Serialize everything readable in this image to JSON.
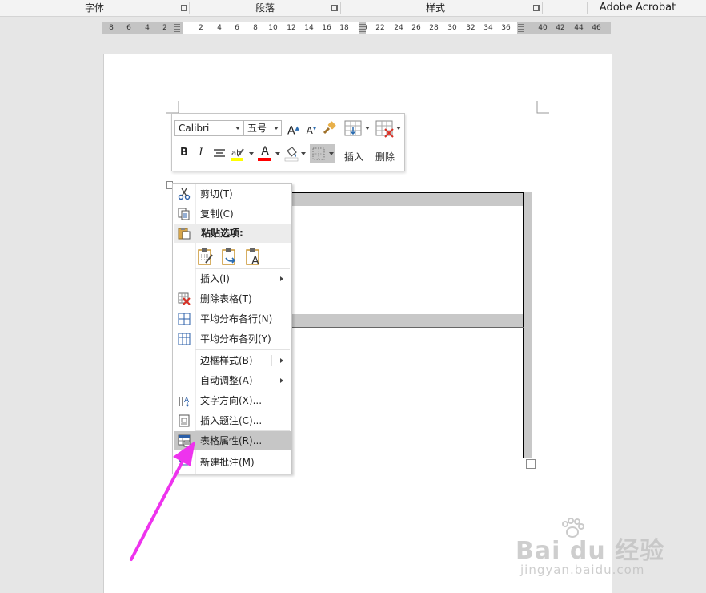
{
  "ribbon": {
    "groups": [
      "字体",
      "段落",
      "样式",
      "Adobe Acrobat"
    ]
  },
  "ruler": {
    "left_ticks": [
      "8",
      "6",
      "4",
      "2"
    ],
    "right_ticks": [
      "2",
      "4",
      "6",
      "8",
      "10",
      "12",
      "14",
      "16",
      "18",
      "20",
      "22",
      "24",
      "26",
      "28",
      "30",
      "32",
      "34",
      "36",
      "40",
      "42",
      "44",
      "46"
    ]
  },
  "mini_toolbar": {
    "font_name": "Calibri",
    "font_size": "五号",
    "insert_label": "插入",
    "delete_label": "删除",
    "bold": "B",
    "italic": "I",
    "grow": "A",
    "shrink": "A",
    "font_color_glyph": "A",
    "highlight_color": "#ffff00",
    "font_color": "#ff0000"
  },
  "context_menu": {
    "items": [
      {
        "label": "剪切(T)",
        "icon": "scissors-icon"
      },
      {
        "label": "复制(C)",
        "icon": "copy-icon"
      },
      {
        "label": "粘贴选项:",
        "icon": "paste-icon"
      },
      {
        "label": "插入(I)",
        "icon": "",
        "submenu": true
      },
      {
        "label": "删除表格(T)",
        "icon": "delete-table-icon"
      },
      {
        "label": "平均分布各行(N)",
        "icon": "distribute-rows-icon"
      },
      {
        "label": "平均分布各列(Y)",
        "icon": "distribute-columns-icon"
      },
      {
        "label": "边框样式(B)",
        "icon": "",
        "submenu": true
      },
      {
        "label": "自动调整(A)",
        "icon": "",
        "submenu": true
      },
      {
        "label": "文字方向(X)...",
        "icon": "text-direction-icon"
      },
      {
        "label": "插入题注(C)...",
        "icon": "insert-caption-icon"
      },
      {
        "label": "表格属性(R)...",
        "icon": "table-properties-icon",
        "highlighted": true
      },
      {
        "label": "新建批注(M)",
        "icon": "new-comment-icon"
      }
    ],
    "paste_options": [
      "keep-source-formatting-icon",
      "merge-formatting-icon",
      "keep-text-only-icon"
    ]
  },
  "annotation_color": "#ee33ee",
  "watermark": {
    "brand": "Bai du 经验",
    "url": "jingyan.baidu.com"
  }
}
